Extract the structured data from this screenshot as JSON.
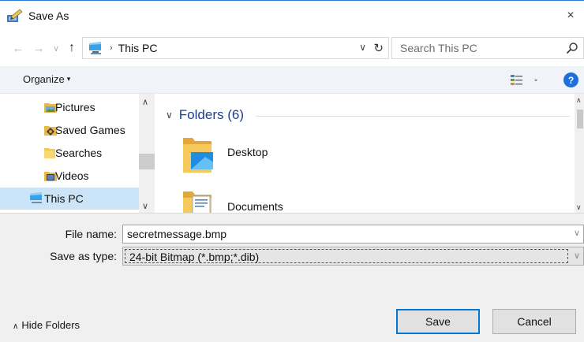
{
  "window": {
    "title": "Save As",
    "close_glyph": "×",
    "app_icon": "save-as-pencil-icon"
  },
  "address": {
    "path_item": "This PC",
    "path_icon": "this-pc-icon",
    "search_placeholder": "Search This PC"
  },
  "nav_glyphs": {
    "back": "←",
    "forward": "→",
    "recent": "∨",
    "up": "↑",
    "breadcrumb_sep": "›",
    "dropdown": "∨",
    "refresh": "↻"
  },
  "toolbar": {
    "organize_label": "Organize",
    "organize_caret": "▾",
    "help_label": "?"
  },
  "nav_pane": {
    "items": [
      {
        "label": "Pictures",
        "icon": "pictures-folder-icon"
      },
      {
        "label": "Saved Games",
        "icon": "saved-games-folder-icon"
      },
      {
        "label": "Searches",
        "icon": "searches-folder-icon"
      },
      {
        "label": "Videos",
        "icon": "videos-folder-icon"
      },
      {
        "label": "This PC",
        "icon": "this-pc-icon",
        "selected": true
      }
    ],
    "scroll_up": "∧",
    "scroll_down": "∨"
  },
  "main_pane": {
    "group_chevron": "∨",
    "group_title": "Folders (6)",
    "items": [
      {
        "label": "Desktop",
        "icon": "desktop-folder-icon"
      },
      {
        "label": "Documents",
        "icon": "documents-folder-icon"
      }
    ],
    "scroll_up": "∧",
    "scroll_down": "∨"
  },
  "form": {
    "filename_label": "File name:",
    "filename_value": "secretmessage.bmp",
    "savetype_label": "Save as type:",
    "savetype_value": "24-bit Bitmap (*.bmp;*.dib)",
    "dropdown_caret": "∨"
  },
  "footer": {
    "hide_folders_chevron": "∧",
    "hide_folders_label": "Hide Folders",
    "save_label": "Save",
    "cancel_label": "Cancel"
  },
  "colors": {
    "accent": "#0078d7",
    "group_title": "#1e3f8a",
    "selection": "#cce4f7",
    "toolbar_bg": "#f0f4f9",
    "form_bg": "#f0f0f0"
  }
}
